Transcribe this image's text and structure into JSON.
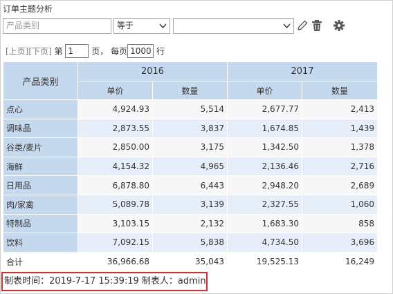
{
  "title": "订单主题分析",
  "filter": {
    "field_placeholder": "产品类别",
    "operator": "等于",
    "value": "",
    "icons": [
      "chevron-down-icon",
      "pencil-icon",
      "trash-icon",
      "gear-icon"
    ]
  },
  "pager": {
    "prev": "[上页]",
    "next": "[下页]",
    "page_prefix": "第",
    "page_value": "1",
    "page_suffix": "页，",
    "per_page_prefix": "每页",
    "per_page_value": "1000",
    "per_page_suffix": "行"
  },
  "table": {
    "row_header": "产品类别",
    "years": [
      "2016",
      "2017"
    ],
    "measures": [
      "单价",
      "数量",
      "单价",
      "数量"
    ],
    "rows": [
      {
        "category": "点心",
        "values": [
          "4,924.93",
          "5,514",
          "2,677.77",
          "2,413"
        ]
      },
      {
        "category": "调味品",
        "values": [
          "2,873.55",
          "3,837",
          "1,674.85",
          "1,439"
        ]
      },
      {
        "category": "谷类/麦片",
        "values": [
          "2,850.00",
          "3,175",
          "1,342.50",
          "1,378"
        ]
      },
      {
        "category": "海鲜",
        "values": [
          "4,154.32",
          "4,965",
          "2,136.46",
          "2,716"
        ]
      },
      {
        "category": "日用品",
        "values": [
          "6,878.80",
          "6,443",
          "2,948.20",
          "2,689"
        ]
      },
      {
        "category": "肉/家禽",
        "values": [
          "5,089.78",
          "3,139",
          "2,327.55",
          "1,060"
        ]
      },
      {
        "category": "特制品",
        "values": [
          "3,103.15",
          "2,132",
          "1,683.30",
          "858"
        ]
      },
      {
        "category": "饮料",
        "values": [
          "7,092.15",
          "5,838",
          "4,734.50",
          "3,696"
        ]
      }
    ],
    "total": {
      "category": "合计",
      "values": [
        "36,966.68",
        "35,043",
        "19,525.13",
        "16,249"
      ]
    }
  },
  "footer": "制表时间：2019-7-17 15:39:19   制表人：admin",
  "colors": {
    "header_bg": "#c5d9ee",
    "stripe": "#e6eefa",
    "highlight_border": "#d32f2f"
  }
}
